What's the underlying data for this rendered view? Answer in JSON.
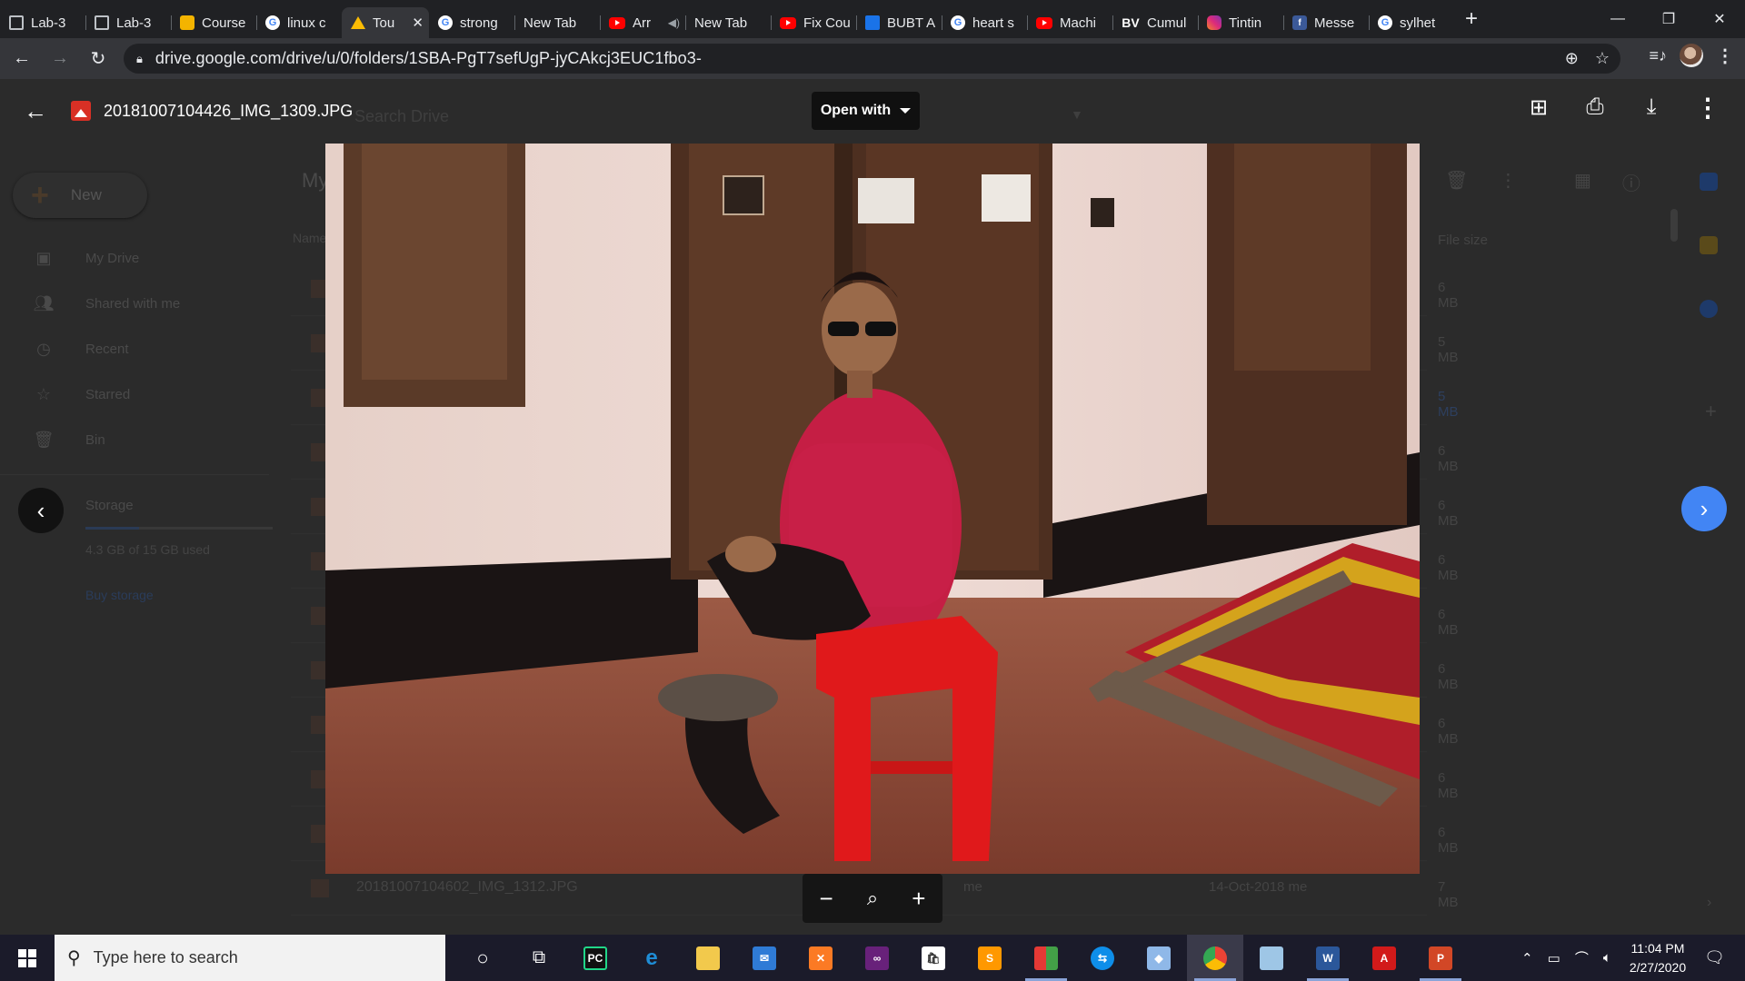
{
  "browser": {
    "tabs": [
      {
        "title": "Lab-3",
        "icon": "image-icon"
      },
      {
        "title": "Lab-3",
        "icon": "image-icon"
      },
      {
        "title": "Course",
        "icon": "slides-icon"
      },
      {
        "title": "linux c",
        "icon": "google-icon"
      },
      {
        "title": "Tou",
        "icon": "drive-icon",
        "active": true
      },
      {
        "title": "strong",
        "icon": "google-icon"
      },
      {
        "title": "New Tab",
        "icon": ""
      },
      {
        "title": "Arr",
        "icon": "youtube-icon",
        "audio": true
      },
      {
        "title": "New Tab",
        "icon": ""
      },
      {
        "title": "Fix Cou",
        "icon": "youtube-icon"
      },
      {
        "title": "BUBT A",
        "icon": "bubt-icon"
      },
      {
        "title": "heart s",
        "icon": "google-icon"
      },
      {
        "title": "Machi",
        "icon": "youtube-icon"
      },
      {
        "title": "Cumul",
        "icon": "bv-icon"
      },
      {
        "title": "Tintin",
        "icon": "instagram-icon"
      },
      {
        "title": "Messe",
        "icon": "facebook-icon"
      },
      {
        "title": "sylhet",
        "icon": "google-icon"
      }
    ],
    "new_tab_symbol": "+",
    "url": "drive.google.com/drive/u/0/folders/1SBA-PgT7sefUgP-jyCAkcj3EUC1fbo3-"
  },
  "drive": {
    "search_placeholder": "Search Drive",
    "page_title": "My",
    "new_button": "New",
    "sidebar": [
      {
        "label": "My Drive",
        "icon": "drive-folder-icon"
      },
      {
        "label": "Shared with me",
        "icon": "people-icon"
      },
      {
        "label": "Recent",
        "icon": "clock-icon"
      },
      {
        "label": "Starred",
        "icon": "star-icon"
      },
      {
        "label": "Bin",
        "icon": "trash-icon"
      }
    ],
    "storage_label": "Storage",
    "storage_used_text": "4.3 GB of 15 GB used",
    "storage_fraction": 0.287,
    "buy_storage": "Buy storage",
    "col_name": "Name",
    "col_size": "File size",
    "file_sizes": [
      "6 MB",
      "5 MB",
      "5 MB",
      "6 MB",
      "6 MB",
      "6 MB",
      "6 MB",
      "6 MB",
      "6 MB",
      "6 MB",
      "6 MB"
    ],
    "last_row": {
      "name": "20181007104602_IMG_1312.JPG",
      "owner": "me",
      "modified": "14-Oct-2018 me",
      "size": "7 MB"
    }
  },
  "viewer": {
    "file_name": "20181007104426_IMG_1309.JPG",
    "open_with": "Open with",
    "zoom_out": "−",
    "zoom_reset_icon": "magnifier-icon",
    "zoom_in": "+"
  },
  "taskbar": {
    "search_placeholder": "Type here to search",
    "time": "11:04 PM",
    "date": "2/27/2020"
  },
  "colors": {
    "drive_blue": "#4285f4",
    "chrome_dark": "#202124",
    "toolbar_dark": "#35363a"
  }
}
